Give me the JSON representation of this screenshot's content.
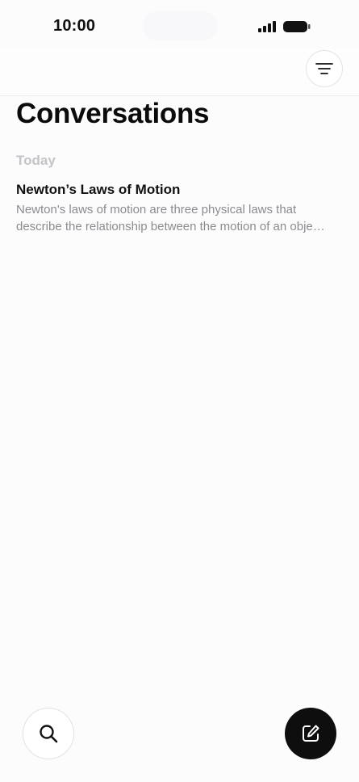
{
  "status_bar": {
    "time": "10:00"
  },
  "header": {
    "title": "Conversations",
    "filter_icon": "filter-lines-icon"
  },
  "sections": [
    {
      "label": "Today",
      "items": [
        {
          "title": "Newton’s Laws of Motion",
          "preview": "Newton's laws of motion are three physical laws that describe the relationship between the motion of an obje…"
        }
      ]
    }
  ],
  "actions": {
    "search_icon": "search-icon",
    "compose_icon": "compose-icon"
  },
  "colors": {
    "background": "#fcfcfd",
    "compose_button": "#0e0e0f",
    "section_label": "#c4c4c8",
    "preview_text": "#8b8b90"
  }
}
